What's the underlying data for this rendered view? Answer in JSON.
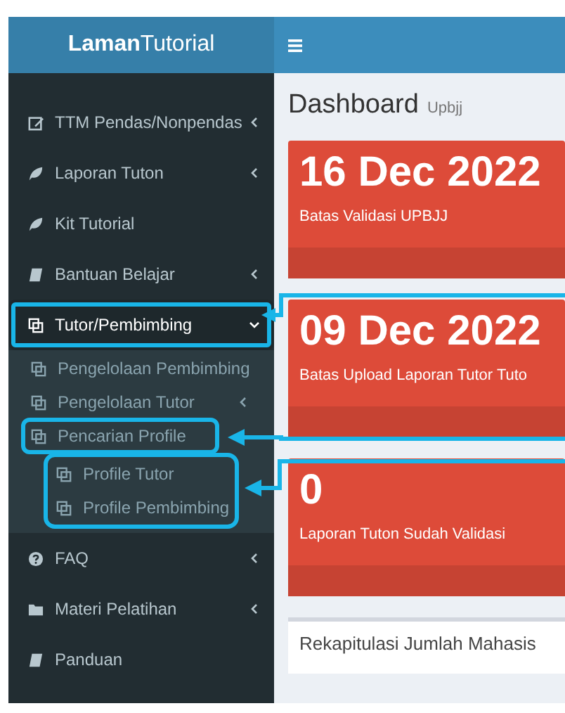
{
  "header": {
    "logo": "**Laman**Tutorial"
  },
  "sidebar": {
    "items": [
      {
        "label": "TTM Pendas/Nonpendas",
        "selected": false,
        "expanded": false
      },
      {
        "label": "Laporan Tuton",
        "selected": false,
        "expanded": false
      },
      {
        "label": "Kit Tutorial",
        "selected": false
      },
      {
        "label": "Bantuan Belajar",
        "selected": false,
        "expanded": false
      },
      {
        "label": "Tutor/Pembimbing",
        "selected": true,
        "expanded": true,
        "highlighted": true,
        "children": [
          {
            "label": "Pengelolaan Pembimbing"
          },
          {
            "label": "Pengelolaan Tutor",
            "expanded": false
          },
          {
            "label": "Pencarian Profile",
            "highlighted": true,
            "children_highlighted": true,
            "children": [
              {
                "label": "Profile Tutor"
              },
              {
                "label": "Profile Pembimbing"
              }
            ]
          }
        ]
      },
      {
        "label": "FAQ",
        "selected": false,
        "expanded": false
      },
      {
        "label": "Materi Pelatihan",
        "selected": false,
        "expanded": false
      },
      {
        "label": "Panduan",
        "selected": false
      }
    ]
  },
  "content": {
    "title": "Dashboard",
    "subtitle": "Upbjj",
    "cards": [
      {
        "value": "16 Dec 2022",
        "label": "Batas Validasi UPBJJ"
      },
      {
        "value": "09 Dec 2022",
        "label": "Batas Upload Laporan Tutor Tuto"
      },
      {
        "value": "0",
        "label": "Laporan Tuton Sudah Validasi"
      }
    ],
    "box_title": "Rekapitulasi Jumlah Mahasis"
  }
}
